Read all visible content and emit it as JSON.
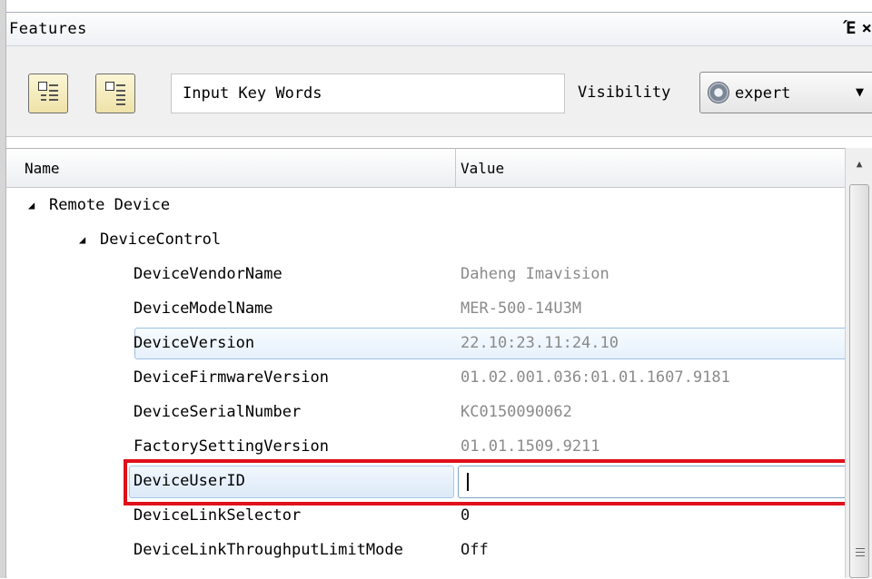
{
  "window": {
    "title": "Features",
    "float_glyph": "Έ",
    "close_glyph": "×"
  },
  "toolbar": {
    "expand_button": "expand-all-icon",
    "collapse_button": "collapse-all-icon",
    "search_placeholder": "Input Key Words",
    "visibility_label": "Visibility",
    "visibility_value": "expert",
    "visibility_icon": "gear-icon"
  },
  "grid": {
    "header_name": "Name",
    "header_value": "Value",
    "rows": [
      {
        "name": "Remote Device",
        "value": "",
        "toggle": "◢"
      },
      {
        "name": "DeviceControl",
        "value": "",
        "toggle": "◢"
      },
      {
        "name": "DeviceVendorName",
        "value": "Daheng Imavision"
      },
      {
        "name": "DeviceModelName",
        "value": "MER-500-14U3M"
      },
      {
        "name": "DeviceVersion",
        "value": "22.10:23.11:24.10"
      },
      {
        "name": "DeviceFirmwareVersion",
        "value": "01.02.001.036:01.01.1607.9181"
      },
      {
        "name": "DeviceSerialNumber",
        "value": "KC0150090062"
      },
      {
        "name": "FactorySettingVersion",
        "value": "01.01.1509.9211"
      },
      {
        "name": "DeviceUserID",
        "value": ""
      },
      {
        "name": "DeviceLinkSelector",
        "value": "0"
      },
      {
        "name": "DeviceLinkThroughputLimitMode",
        "value": "Off"
      }
    ]
  },
  "colors": {
    "highlight": "#e0101a",
    "selection": "#9dbfe3"
  }
}
